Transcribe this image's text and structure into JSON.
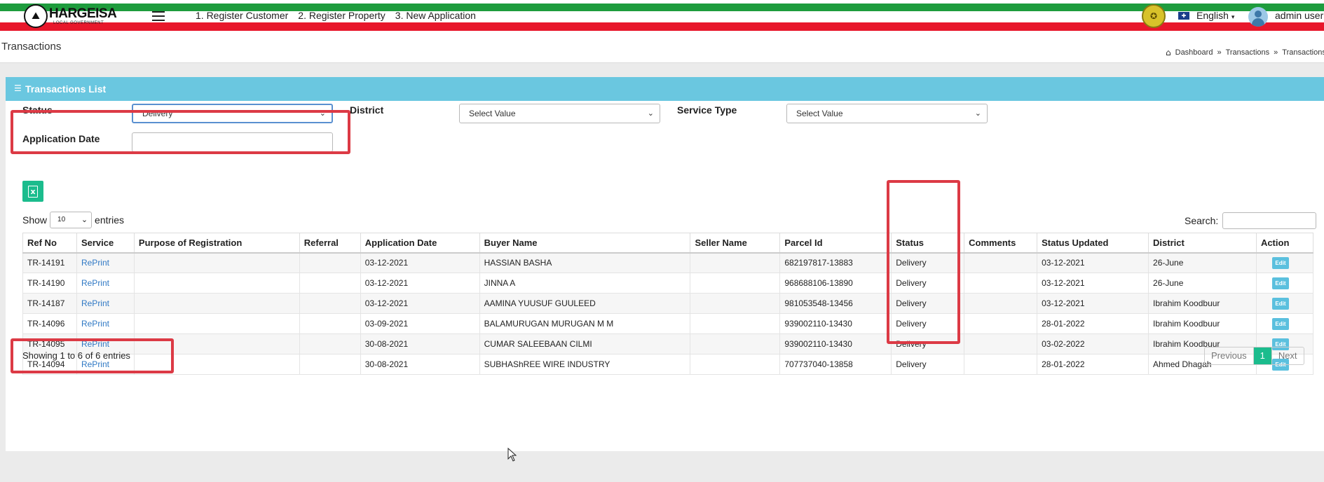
{
  "brand": {
    "name": "HARGEISA",
    "subtitle": "LOCAL GOVERNMENT"
  },
  "topnav": {
    "items": [
      "1. Register Customer",
      "2. Register Property",
      "3. New Application"
    ],
    "language": "English",
    "user": "admin user"
  },
  "header": {
    "title": "Transactions",
    "breadcrumb": [
      "Dashboard",
      "Transactions",
      "Transactions List"
    ]
  },
  "panel": {
    "title": "Transactions List"
  },
  "filters": {
    "status_label": "Status",
    "status_value": "Delivery",
    "district_label": "District",
    "district_value": "Select Value",
    "service_label": "Service Type",
    "service_value": "Select Value",
    "date_label": "Application Date"
  },
  "table_controls": {
    "show": "Show",
    "entries_value": "10",
    "entries": "entries",
    "search": "Search:"
  },
  "table": {
    "headers": [
      "Ref No",
      "Service",
      "Purpose of Registration",
      "Referral",
      "Application Date",
      "Buyer Name",
      "Seller Name",
      "Parcel Id",
      "Status",
      "Comments",
      "Status Updated",
      "District",
      "Action"
    ],
    "rows": [
      {
        "ref": "TR-14191",
        "service": "RePrint",
        "purpose": "",
        "referral": "",
        "app_date": "03-12-2021",
        "buyer": "HASSIAN BASHA",
        "seller": "",
        "parcel": "682197817-13883",
        "status": "Delivery",
        "comments": "",
        "updated": "03-12-2021",
        "district": "26-June",
        "action": "Edit"
      },
      {
        "ref": "TR-14190",
        "service": "RePrint",
        "purpose": "",
        "referral": "",
        "app_date": "03-12-2021",
        "buyer": "JINNA A",
        "seller": "",
        "parcel": "968688106-13890",
        "status": "Delivery",
        "comments": "",
        "updated": "03-12-2021",
        "district": "26-June",
        "action": "Edit"
      },
      {
        "ref": "TR-14187",
        "service": "RePrint",
        "purpose": "",
        "referral": "",
        "app_date": "03-12-2021",
        "buyer": "AAMINA YUUSUF GUULEED",
        "seller": "",
        "parcel": "981053548-13456",
        "status": "Delivery",
        "comments": "",
        "updated": "03-12-2021",
        "district": "Ibrahim Koodbuur",
        "action": "Edit"
      },
      {
        "ref": "TR-14096",
        "service": "RePrint",
        "purpose": "",
        "referral": "",
        "app_date": "03-09-2021",
        "buyer": "BALAMURUGAN MURUGAN M M",
        "seller": "",
        "parcel": "939002110-13430",
        "status": "Delivery",
        "comments": "",
        "updated": "28-01-2022",
        "district": "Ibrahim Koodbuur",
        "action": "Edit"
      },
      {
        "ref": "TR-14095",
        "service": "RePrint",
        "purpose": "",
        "referral": "",
        "app_date": "30-08-2021",
        "buyer": "CUMAR SALEEBAAN CILMI",
        "seller": "",
        "parcel": "939002110-13430",
        "status": "Delivery",
        "comments": "",
        "updated": "03-02-2022",
        "district": "Ibrahim Koodbuur",
        "action": "Edit"
      },
      {
        "ref": "TR-14094",
        "service": "RePrint",
        "purpose": "",
        "referral": "",
        "app_date": "30-08-2021",
        "buyer": "SUBHAShREE WIRE INDUSTRY",
        "seller": "",
        "parcel": "707737040-13858",
        "status": "Delivery",
        "comments": "",
        "updated": "28-01-2022",
        "district": "Ahmed Dhagah",
        "action": "Edit"
      }
    ]
  },
  "footer": {
    "info": "Showing 1 to 6 of 6 entries",
    "prev": "Previous",
    "page": "1",
    "next": "Next"
  },
  "colors": {
    "accent": "#1bbc8d",
    "panel_header": "#6ac7e0",
    "highlight": "#dc3a45"
  }
}
